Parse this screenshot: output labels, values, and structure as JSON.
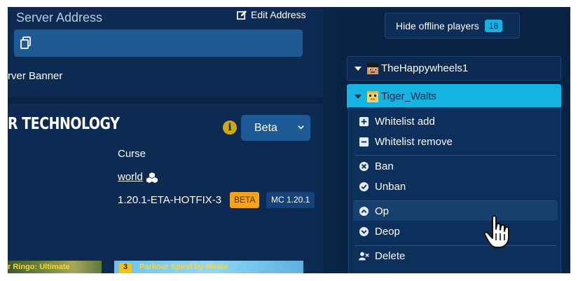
{
  "server": {
    "address_label": "Server Address",
    "edit_address_label": "Edit Address",
    "banner_label": "rver Banner"
  },
  "modpack": {
    "title": "R TECHNOLOGY",
    "channel_selected": "Beta",
    "platform": "Curse",
    "world_link": "world",
    "version": "1.20.1-ETA-HOTFIX-3",
    "badge_beta": "BETA",
    "badge_mc": "MC 1.20.1"
  },
  "thumbnails": [
    {
      "text": "r Ringo: Ultimate"
    },
    {
      "number": "3",
      "text": "Parkour Spiral by Hielke"
    }
  ],
  "players_panel": {
    "hide_offline_label": "Hide offline players",
    "player_count": "18",
    "players": [
      {
        "name": "TheHappywheels1",
        "expanded": false
      },
      {
        "name": "Tiger_Walts",
        "expanded": true
      }
    ],
    "menu": [
      {
        "label": "Whitelist add",
        "icon": "plus-square-icon"
      },
      {
        "label": "Whitelist remove",
        "icon": "minus-square-icon"
      },
      {
        "label": "Ban",
        "icon": "x-circle-icon"
      },
      {
        "label": "Unban",
        "icon": "check-circle-icon"
      },
      {
        "label": "Op",
        "icon": "chevron-up-circle-icon",
        "hovered": true
      },
      {
        "label": "Deop",
        "icon": "chevron-down-circle-icon"
      },
      {
        "label": "Delete",
        "icon": "user-x-icon"
      }
    ]
  },
  "colors": {
    "background": "#0b2447",
    "accent": "#15b3e1",
    "primary_button": "#1e5a96",
    "beta_badge": "#f7a21b",
    "info_icon": "#d1a80f"
  }
}
